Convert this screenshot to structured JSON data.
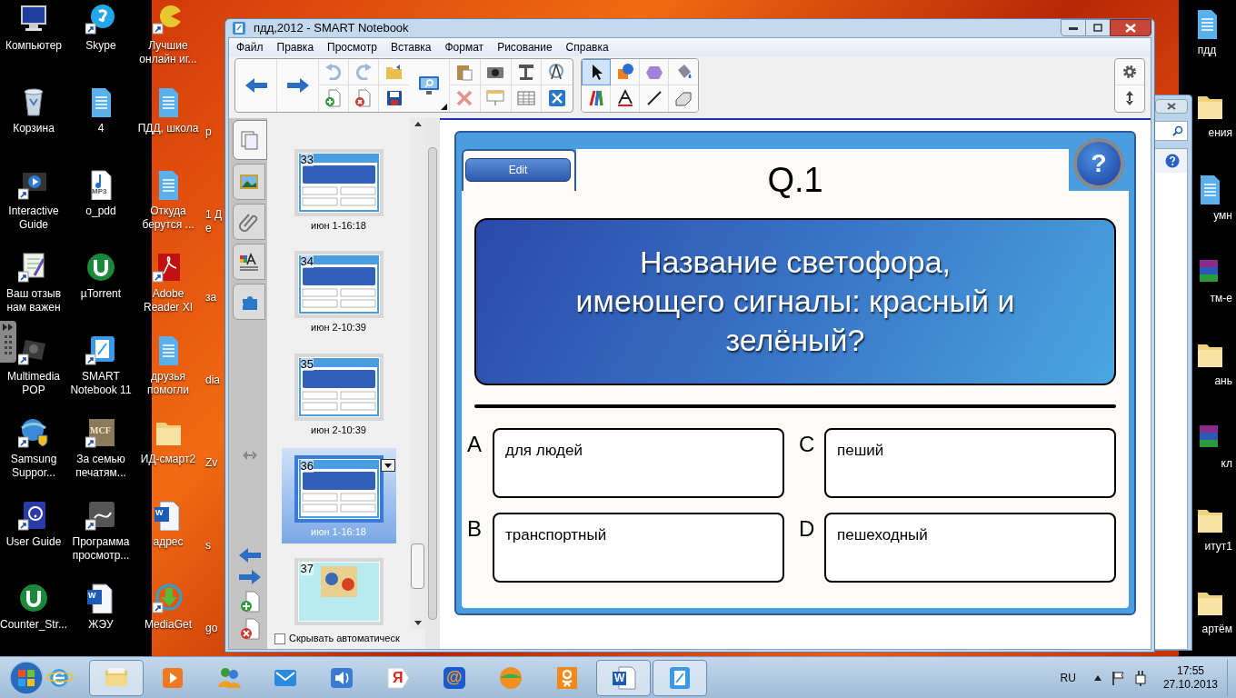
{
  "desktop": {
    "columns": [
      [
        {
          "label": "Компьютер",
          "kind": "computer"
        },
        {
          "label": "Корзина",
          "kind": "recycle"
        },
        {
          "label": "Interactive Guide",
          "kind": "screen"
        },
        {
          "label": "Ваш отзыв нам важен",
          "kind": "form"
        },
        {
          "label": "Multimedia POP",
          "kind": "media"
        },
        {
          "label": "Samsung Suppor...",
          "kind": "globe"
        },
        {
          "label": "User Guide",
          "kind": "book"
        },
        {
          "label": "Counter_Str...",
          "kind": "torrent"
        }
      ],
      [
        {
          "label": "Skype",
          "kind": "bubble"
        },
        {
          "label": "4",
          "kind": "doc"
        },
        {
          "label": "o_pdd",
          "kind": "music",
          "glyph": "MP3"
        },
        {
          "label": "µTorrent",
          "kind": "torrent"
        },
        {
          "label": "SMART Notebook 11",
          "kind": "notebook"
        },
        {
          "label": "За семью печатям...",
          "kind": "picture",
          "glyph": "MCF"
        },
        {
          "label": "Программа просмотр...",
          "kind": "viewer"
        },
        {
          "label": "ЖЭУ",
          "kind": "word",
          "glyph": "W"
        }
      ],
      [
        {
          "label": "Лучшие онлайн иг...",
          "kind": "game"
        },
        {
          "label": "ПДД, школа",
          "kind": "doc"
        },
        {
          "label": "Откуда берутся ...",
          "kind": "doc"
        },
        {
          "label": "Adobe Reader XI",
          "kind": "pdf"
        },
        {
          "label": "друзья помогли",
          "kind": "doc"
        },
        {
          "label": "ИД-смарт2",
          "kind": "folder"
        },
        {
          "label": "адрес",
          "kind": "word",
          "glyph": "W"
        },
        {
          "label": "MediaGet",
          "kind": "download"
        }
      ]
    ],
    "partial_column": [
      "р",
      "1 Де",
      "за",
      "dia",
      "Zv",
      "s",
      "go"
    ],
    "right_column": [
      {
        "label": "пдд",
        "kind": "doc"
      },
      {
        "label": "ения",
        "kind": "folder"
      },
      {
        "label": "умн",
        "kind": "doc"
      },
      {
        "label": "тм-е",
        "kind": "archive"
      },
      {
        "label": "ань",
        "kind": "folder"
      },
      {
        "label": "кл",
        "kind": "archive"
      },
      {
        "label": "итут1",
        "kind": "folder"
      },
      {
        "label": "артём",
        "kind": "folder"
      }
    ]
  },
  "window": {
    "title": "пдд,2012 - SMART Notebook",
    "menu": [
      "Файл",
      "Правка",
      "Просмотр",
      "Вставка",
      "Формат",
      "Рисование",
      "Справка"
    ],
    "tools": [
      {
        "kind": "select",
        "selected": true
      },
      {
        "kind": "shapes",
        "selected": false
      },
      {
        "kind": "polygon",
        "selected": false
      },
      {
        "kind": "fill",
        "selected": false
      },
      {
        "kind": "pens",
        "selected": false
      },
      {
        "kind": "text",
        "selected": false
      },
      {
        "kind": "line",
        "selected": false
      },
      {
        "kind": "eraser",
        "selected": false
      }
    ],
    "side_tabs": [
      {
        "kind": "pages",
        "selected": true
      },
      {
        "kind": "gallery",
        "selected": false
      },
      {
        "kind": "attachments",
        "selected": false
      },
      {
        "kind": "properties",
        "selected": false
      },
      {
        "kind": "addons",
        "selected": false
      }
    ],
    "thumbnails": [
      {
        "number": "33",
        "label": "июн 1-16:18",
        "kind": "quiz",
        "selected": false
      },
      {
        "number": "34",
        "label": "июн 2-10:39",
        "kind": "quiz",
        "selected": false
      },
      {
        "number": "35",
        "label": "июн 2-10:39",
        "kind": "quiz",
        "selected": false
      },
      {
        "number": "36",
        "label": "июн 1-16:18",
        "kind": "quiz",
        "selected": true
      },
      {
        "number": "37",
        "kind": "picture",
        "selected": false
      }
    ],
    "autohide": {
      "label": "Скрывать автоматическ",
      "checked": false
    },
    "slide": {
      "edit_label": "Edit",
      "title": "Q.1",
      "help": "?",
      "question": "Название светофора,\nимеющего сигналы: красный и\nзелёный?",
      "answers": [
        {
          "letter": "A",
          "text": "для людей"
        },
        {
          "letter": "C",
          "text": "пеший"
        },
        {
          "letter": "B",
          "text": "транспортный"
        },
        {
          "letter": "D",
          "text": "пешеходный"
        }
      ]
    }
  },
  "taskbar": {
    "items": [
      {
        "kind": "ie",
        "active": false
      },
      {
        "kind": "explorer",
        "active": true
      },
      {
        "kind": "player",
        "active": false
      },
      {
        "kind": "messenger",
        "active": false
      },
      {
        "kind": "mail",
        "active": false
      },
      {
        "kind": "sound",
        "active": false
      },
      {
        "kind": "yandex",
        "active": false,
        "glyph": "Я"
      },
      {
        "kind": "atmail",
        "active": false,
        "glyph": "@"
      },
      {
        "kind": "ball",
        "active": false
      },
      {
        "kind": "ok",
        "active": false
      },
      {
        "kind": "word",
        "active": true,
        "glyph": "W"
      },
      {
        "kind": "notebook",
        "active": true
      }
    ],
    "language": "RU",
    "time": "17:55",
    "date": "27.10.2013"
  }
}
